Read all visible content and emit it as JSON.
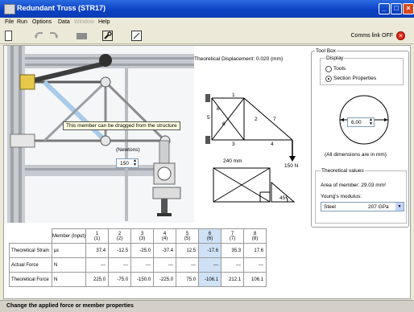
{
  "window": {
    "title": "Redundant Truss (STR17)"
  },
  "menu": [
    "File",
    "Run",
    "Options",
    "Data",
    "Window",
    "Help"
  ],
  "toolbar": {
    "comms_label": "Comms link OFF"
  },
  "rig": {
    "tooltip": "This member can be dragged from the structure",
    "newtons_label": "(Newtons)",
    "force_value": "150"
  },
  "diagram": {
    "displacement_label": "Theoretical Displacement: 0.020 (mm)",
    "node_labels": [
      "1",
      "2",
      "3",
      "4",
      "5",
      "6",
      "7",
      "8"
    ],
    "load_label": "150 N",
    "span_label": "240 mm",
    "angle_label": "45°"
  },
  "toolbox": {
    "title": "Tool Box",
    "display_label": "Display",
    "options": [
      {
        "label": "Tools",
        "selected": false
      },
      {
        "label": "Section Properties",
        "selected": true
      }
    ],
    "diameter_value": "6.00",
    "dimensions_note": "(All dimensions are in mm)",
    "theoretical_title": "Theoretical values",
    "area_text": "Area of member: 29.03 mm²",
    "youngs_label": "Young's modulus:",
    "material": "Steel",
    "modulus": "207 GPa"
  },
  "table": {
    "header_first": "Member (Input)",
    "members": [
      {
        "top": "1",
        "bottom": "(1)"
      },
      {
        "top": "2",
        "bottom": "(2)"
      },
      {
        "top": "3",
        "bottom": "(3)"
      },
      {
        "top": "4",
        "bottom": "(4)"
      },
      {
        "top": "5",
        "bottom": "(5)"
      },
      {
        "top": "6",
        "bottom": "(6)"
      },
      {
        "top": "7",
        "bottom": "(7)"
      },
      {
        "top": "8",
        "bottom": "(8)"
      }
    ],
    "rows": [
      {
        "label": "Theoretical Strain",
        "symbol": "με",
        "values": [
          "37.4",
          "-12.5",
          "-25.0",
          "-37.4",
          "12.5",
          "-17.6",
          "35.3",
          "17.6"
        ]
      },
      {
        "label": "Actual Force",
        "symbol": "N",
        "values": [
          "---",
          "---",
          "---",
          "---",
          "---",
          "---",
          "---",
          "---"
        ]
      },
      {
        "label": "Theoretical Force",
        "symbol": "N",
        "values": [
          "225.0",
          "-75.0",
          "-150.0",
          "-225.0",
          "75.0",
          "-106.1",
          "212.1",
          "106.1"
        ]
      }
    ],
    "highlight_column": 6
  },
  "status": {
    "text": "Change the applied force or member properties"
  },
  "colors": {
    "title_blue": "#0a3fc2",
    "highlight": "#cfe2f5",
    "comms_red": "#e12b18"
  }
}
